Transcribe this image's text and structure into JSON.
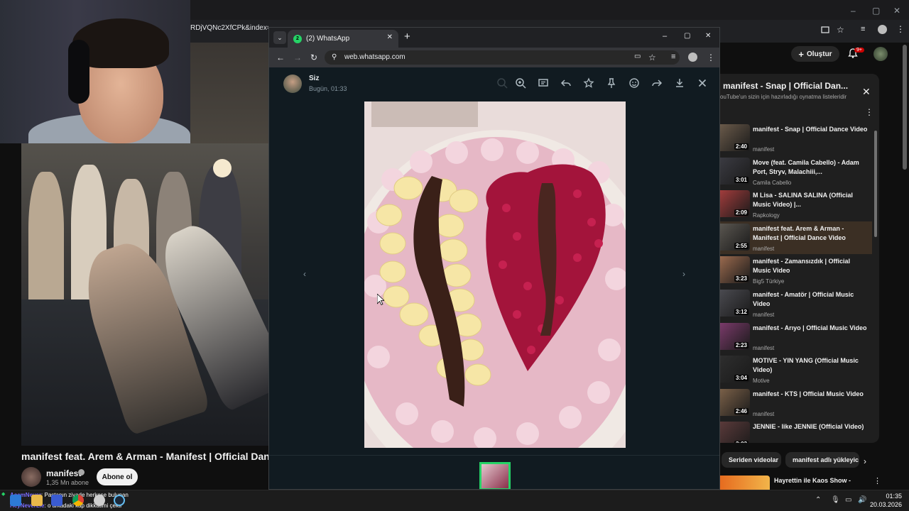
{
  "background_browser": {
    "url_fragment": "RDjVQNc2XfCPk&index=4",
    "window_controls": [
      "–",
      "▢",
      "✕"
    ]
  },
  "youtube": {
    "header": {
      "create_label": "Oluştur",
      "notifications_badge": "9+"
    },
    "video": {
      "title": "manifest feat. Arem & Arman - Manifest | Official Dance Vi",
      "channel": "manifest",
      "subscribers": "1,35 Mn abone",
      "subscribe_label": "Abone ol"
    },
    "playlist": {
      "title": "manifest - Snap | Official Dan...",
      "subtitle": "ouTube'un sizin için hazırladığı oynatma listeleridir",
      "close_icon": "✕",
      "menu_icon": "⋮",
      "items": [
        {
          "title": "manifest - Snap | Official Dance Video",
          "channel": "manifest",
          "duration": "2:40",
          "color": "#6a5a4a"
        },
        {
          "title": "Move (feat. Camila Cabello) - Adam Port, Stryv, Malachiii,...",
          "channel": "Camila Cabello",
          "duration": "3:01",
          "color": "#3b3b42"
        },
        {
          "title": "M Lisa - SALINA SALINA (Official Music Video) |...",
          "channel": "Rapkology",
          "duration": "2:09",
          "color": "#a13c3c"
        },
        {
          "title": "manifest feat. Arem & Arman - Manifest | Official Dance Video",
          "channel": "manifest",
          "duration": "2:55",
          "color": "#5a5650",
          "active": true
        },
        {
          "title": "manifest - Zamansızdık | Official Music Video",
          "channel": "Big5 Türkiye",
          "duration": "3:23",
          "color": "#9a6a4e"
        },
        {
          "title": "manifest - Amatör | Official Music Video",
          "channel": "manifest",
          "duration": "3:12",
          "color": "#4a4a50"
        },
        {
          "title": "manifest - Arıyo | Official Music Video",
          "channel": "manifest",
          "duration": "2:23",
          "color": "#7a3a6a"
        },
        {
          "title": "MOTIVE - YIN YANG (Official Music Video)",
          "channel": "Motive",
          "duration": "3:04",
          "color": "#2e2e2e"
        },
        {
          "title": "manifest - KTS | Official Music Video",
          "channel": "manifest",
          "duration": "2:46",
          "color": "#7a6048"
        },
        {
          "title": "JENNIE - like JENNIE (Official Video)",
          "channel": "",
          "duration": "3:03",
          "color": "#5a3a3a"
        }
      ]
    },
    "chips": [
      "Seriden videolar",
      "manifest adlı yükleyic"
    ],
    "recommendation": {
      "title": "Hayrettin ile Kaos Show -"
    }
  },
  "whatsapp": {
    "tab_title": "(2) WhatsApp",
    "tab_badge": "2",
    "url": "web.whatsapp.com",
    "sender": "Siz",
    "time": "Bugün, 01:33",
    "colors": {
      "accent": "#25d366",
      "background": "#111b21"
    }
  },
  "taskbar": {
    "chat": [
      {
        "user": "AcemNever",
        "message": "Pastanın ziyade herkese bulunan"
      },
      {
        "user": "HeyNeverLie",
        "message": "o arkadaki kap dikkatimi çekti"
      }
    ],
    "time": "01:35",
    "date": "20.03.2026"
  }
}
